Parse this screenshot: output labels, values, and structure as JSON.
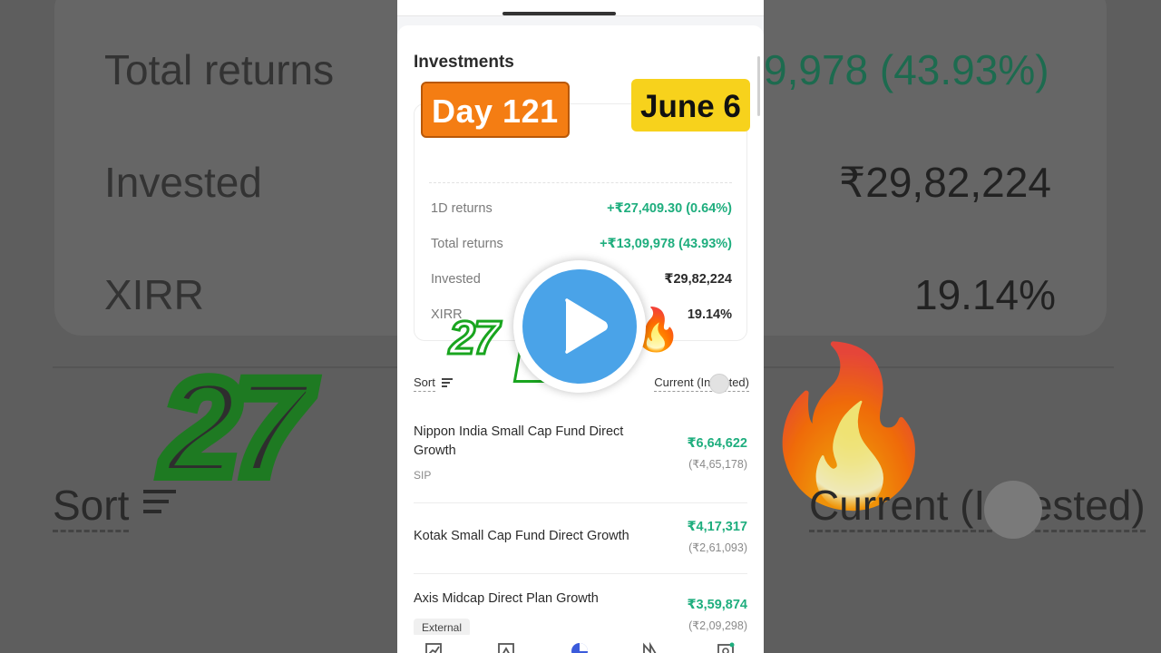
{
  "background": {
    "total_returns_label": "Total returns",
    "total_returns_value": "9,978 (43.93%)",
    "invested_label": "Invested",
    "invested_value": "₹29,82,224",
    "xirr_label": "XIRR",
    "xirr_value": "19.14%",
    "sort_label": "Sort",
    "current_label": "Current (Invested)",
    "streak_text": "27"
  },
  "investments": {
    "title": "Investments",
    "summary": [
      {
        "label": "1D returns",
        "value": "+₹27,409.30 (0.64%)",
        "positive": true
      },
      {
        "label": "Total returns",
        "value": "+₹13,09,978 (43.93%)",
        "positive": true
      },
      {
        "label": "Invested",
        "value": "₹29,82,224",
        "positive": false
      },
      {
        "label": "XIRR",
        "value": "19.14%",
        "positive": false
      }
    ],
    "sort_label": "Sort",
    "current_label": "Current (Invested)",
    "funds": [
      {
        "name": "Nippon India Small Cap Fund Direct Growth",
        "current": "₹6,64,622",
        "invested": "(₹4,65,178)",
        "tag": "SIP"
      },
      {
        "name": "Kotak Small Cap Fund Direct Growth",
        "current": "₹4,17,317",
        "invested": "(₹2,61,093)",
        "tag": ""
      },
      {
        "name": "Axis Midcap Direct Plan Growth",
        "current": "₹3,59,874",
        "invested": "(₹2,09,298)",
        "tag": "External"
      }
    ]
  },
  "overlay": {
    "day_badge": "Day 121",
    "date_badge": "June 6",
    "streak": "27",
    "fire_emoji": "🔥"
  },
  "colors": {
    "positive": "#1fae7e",
    "day_badge": "#f47d13",
    "date_badge": "#f7d21c",
    "play_button": "#4aa3e8",
    "streak_green": "#19a51f"
  }
}
